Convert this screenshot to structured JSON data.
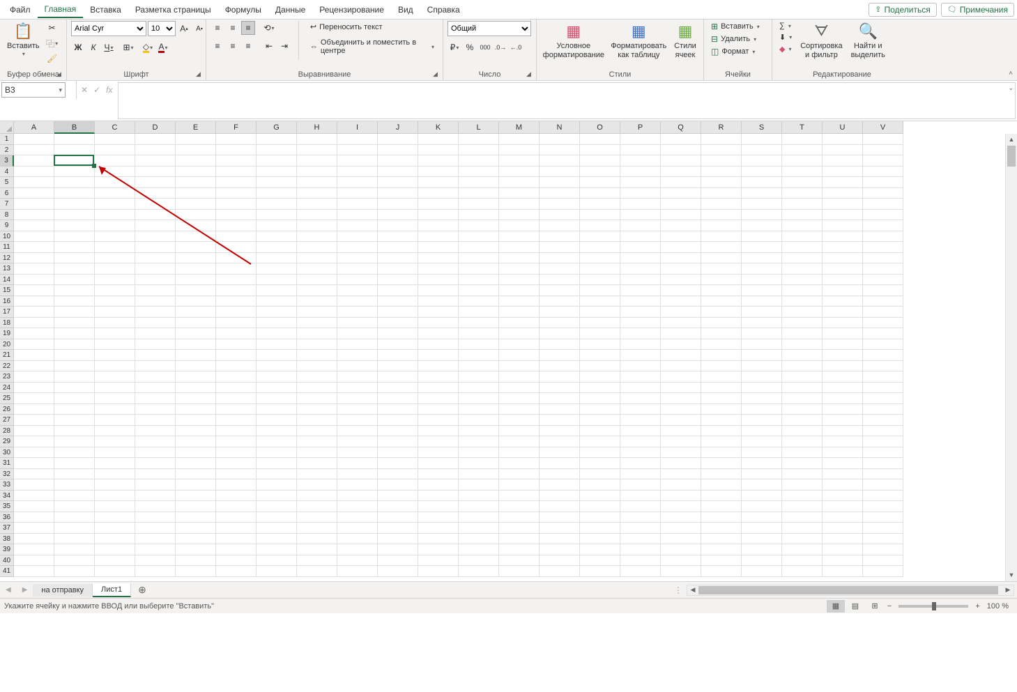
{
  "menu": {
    "items": [
      "Файл",
      "Главная",
      "Вставка",
      "Разметка страницы",
      "Формулы",
      "Данные",
      "Рецензирование",
      "Вид",
      "Справка"
    ],
    "active_index": 1,
    "share": "Поделиться",
    "comments": "Примечания"
  },
  "ribbon": {
    "clipboard": {
      "paste": "Вставить",
      "label": "Буфер обмена"
    },
    "font": {
      "name": "Arial Cyr",
      "size": "10",
      "bold": "Ж",
      "italic": "К",
      "underline": "Ч",
      "label": "Шрифт"
    },
    "alignment": {
      "wrap": "Переносить текст",
      "merge": "Объединить и поместить в центре",
      "label": "Выравнивание"
    },
    "number": {
      "format": "Общий",
      "label": "Число"
    },
    "styles": {
      "cond": "Условное\nформатирование",
      "table": "Форматировать\nкак таблицу",
      "cell": "Стили\nячеек",
      "label": "Стили"
    },
    "cells": {
      "insert": "Вставить",
      "delete": "Удалить",
      "format": "Формат",
      "label": "Ячейки"
    },
    "editing": {
      "sort": "Сортировка\nи фильтр",
      "find": "Найти и\nвыделить",
      "label": "Редактирование"
    }
  },
  "formula_bar": {
    "cell_ref": "B3"
  },
  "grid": {
    "columns": [
      "A",
      "B",
      "C",
      "D",
      "E",
      "F",
      "G",
      "H",
      "I",
      "J",
      "K",
      "L",
      "M",
      "N",
      "O",
      "P",
      "Q",
      "R",
      "S",
      "T",
      "U",
      "V"
    ],
    "rows": 41,
    "selected_col": "B",
    "selected_row": 3
  },
  "tabs": {
    "sheets": [
      "на отправку",
      "Лист1"
    ],
    "active_index": 1
  },
  "status": {
    "message": "Укажите ячейку и нажмите ВВОД или выберите \"Вставить\"",
    "zoom": "100 %"
  }
}
